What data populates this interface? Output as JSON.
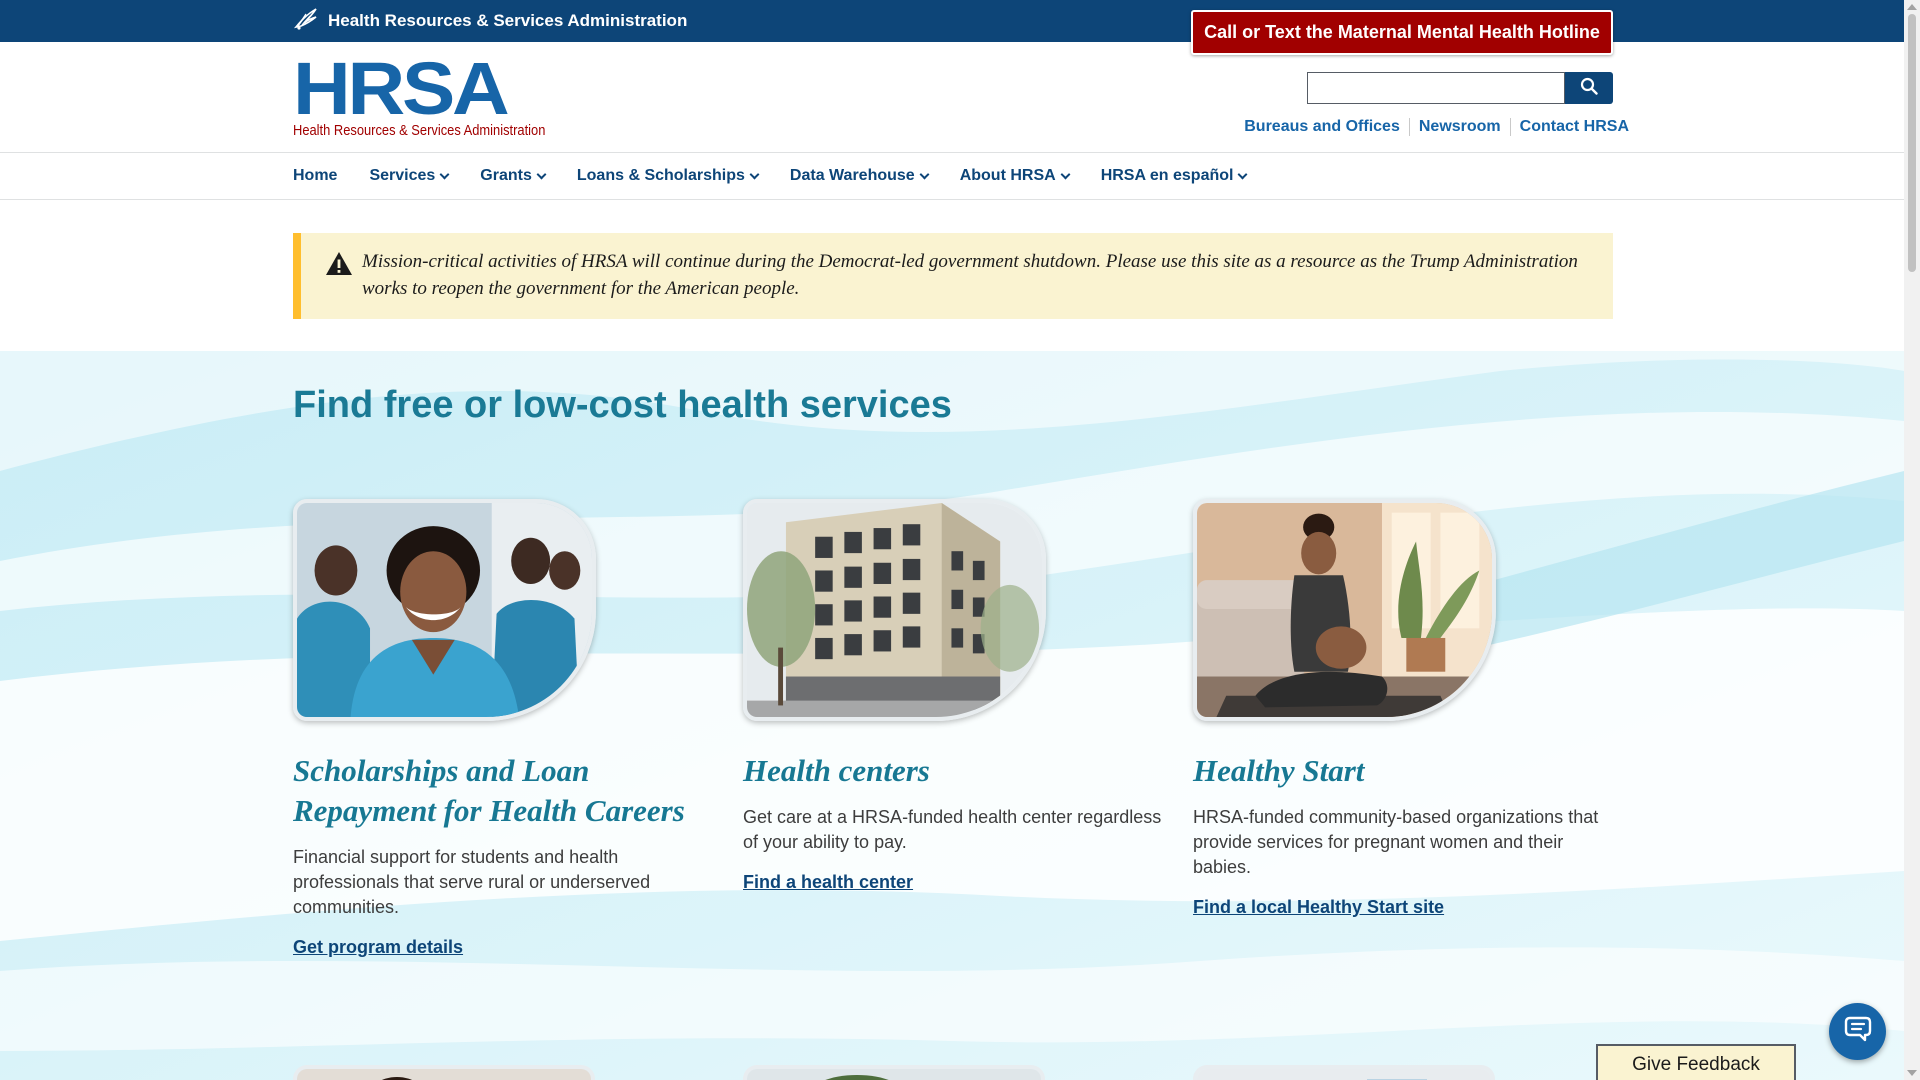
{
  "gov_bar": {
    "agency_name": "Health Resources & Services Administration",
    "hotline_button": "Call or Text the Maternal Mental Health Hotline"
  },
  "header": {
    "logo_text": "HRSA",
    "logo_subtitle": "Health Resources & Services Administration",
    "search": {
      "value": "",
      "placeholder": ""
    },
    "utility_links": [
      "Bureaus and Offices",
      "Newsroom",
      "Contact HRSA"
    ]
  },
  "nav": {
    "items": [
      {
        "label": "Home",
        "has_dropdown": false
      },
      {
        "label": "Services",
        "has_dropdown": true
      },
      {
        "label": "Grants",
        "has_dropdown": true
      },
      {
        "label": "Loans & Scholarships",
        "has_dropdown": true
      },
      {
        "label": "Data Warehouse",
        "has_dropdown": true
      },
      {
        "label": "About HRSA",
        "has_dropdown": true
      },
      {
        "label": "HRSA en español",
        "has_dropdown": true
      }
    ]
  },
  "alert": {
    "icon": "warning-icon",
    "text": "Mission-critical activities of HRSA will continue during the Democrat-led government shutdown. Please use this site as a resource as the Trump Administration works to reopen the government for the American people."
  },
  "hero": {
    "title": "Find free or low-cost health services",
    "cards": [
      {
        "title": "Scholarships and Loan Repayment for Health Careers",
        "description": "Financial support for students and health professionals that serve rural or underserved communities.",
        "link": "Get program details"
      },
      {
        "title": "Health centers",
        "description": "Get care at a HRSA-funded health center regardless of your ability to pay.",
        "link": "Find a health center"
      },
      {
        "title": "Healthy Start",
        "description": "HRSA-funded community-based organizations that provide services for pregnant women and their babies.",
        "link": "Find a local Healthy Start site"
      }
    ]
  },
  "widgets": {
    "feedback_button": "Give Feedback",
    "chat_icon": "chat-icon"
  },
  "colors": {
    "gov_bar": "#0d4578",
    "hotline": "#a10000",
    "link": "#1765a8",
    "heading_teal": "#1a7a95",
    "alert_bg": "#faf3d1",
    "alert_border": "#ffbe2e"
  }
}
